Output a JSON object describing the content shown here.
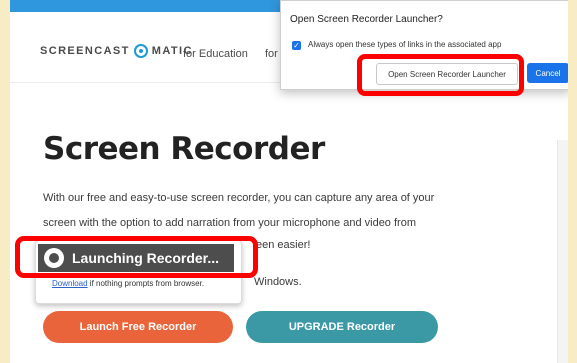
{
  "header": {
    "logo_left": "SCREENCAST",
    "logo_right": "MATIC",
    "nav": [
      "for Education",
      "for"
    ]
  },
  "hero": {
    "title": "Screen Recorder",
    "desc_line1": "With our free and easy-to-use screen recorder, you can capture any area of your",
    "desc_line2": "screen with the option to add narration from your microphone and video from",
    "desc_line3_tail": "een easier!",
    "windows_text": "Windows."
  },
  "buttons": {
    "launch_free": "Launch Free Recorder",
    "upgrade": "UPGRADE Recorder"
  },
  "launch_popup": {
    "status": "Launching Recorder...",
    "download_link": "Download",
    "help_text": " if nothing prompts from browser."
  },
  "dialog": {
    "title": "Open Screen Recorder Launcher?",
    "checkbox_label": "Always open these types of links in the associated app",
    "checkbox_checked": true,
    "open_button": "Open Screen Recorder Launcher",
    "cancel_button": "Cancel"
  },
  "colors": {
    "accent_blue": "#2f97dd",
    "cta_orange": "#e9643a",
    "cta_teal": "#3b99a6",
    "highlight_red": "#ff0000",
    "page_border": "#f7ecc4"
  }
}
